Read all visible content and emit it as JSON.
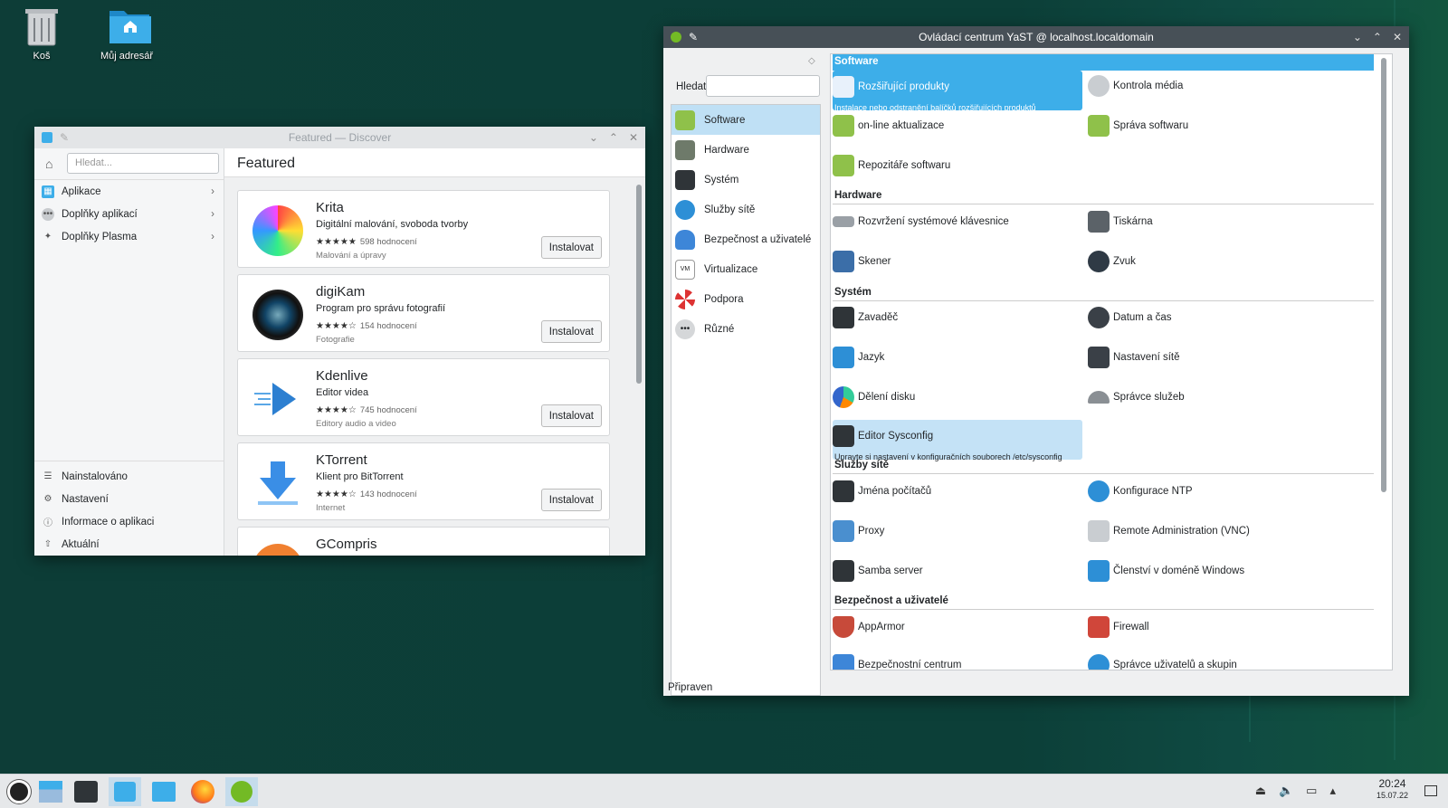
{
  "desktop": {
    "icons": [
      {
        "label": "Koš"
      },
      {
        "label": "Můj adresář"
      }
    ]
  },
  "discover": {
    "title": "Featured — Discover",
    "search_placeholder": "Hledat...",
    "nav": [
      {
        "label": "Aplikace"
      },
      {
        "label": "Doplňky aplikací"
      },
      {
        "label": "Doplňky Plasma"
      }
    ],
    "bottom_nav": [
      {
        "label": "Nainstalováno"
      },
      {
        "label": "Nastavení"
      },
      {
        "label": "Informace o aplikaci"
      },
      {
        "label": "Aktuální"
      }
    ],
    "heading": "Featured",
    "apps": [
      {
        "name": "Krita",
        "desc": "Digitální malování, svoboda tvorby",
        "stars": "★★★★★",
        "ratings": "598 hodnocení",
        "category": "Malování a úpravy",
        "button": "Instalovat"
      },
      {
        "name": "digiKam",
        "desc": "Program pro správu fotografií",
        "stars": "★★★★☆",
        "ratings": "154 hodnocení",
        "category": "Fotografie",
        "button": "Instalovat"
      },
      {
        "name": "Kdenlive",
        "desc": "Editor videa",
        "stars": "★★★★☆",
        "ratings": "745 hodnocení",
        "category": "Editory audio a video",
        "button": "Instalovat"
      },
      {
        "name": "KTorrent",
        "desc": "Klient pro BitTorrent",
        "stars": "★★★★☆",
        "ratings": "143 hodnocení",
        "category": "Internet",
        "button": "Instalovat"
      },
      {
        "name": "GCompris"
      }
    ]
  },
  "yast": {
    "title": "Ovládací centrum YaST @ localhost.localdomain",
    "search_label": "Hledat",
    "categories": [
      {
        "label": "Software"
      },
      {
        "label": "Hardware"
      },
      {
        "label": "Systém"
      },
      {
        "label": "Služby sítě"
      },
      {
        "label": "Bezpečnost a uživatelé"
      },
      {
        "label": "Virtualizace"
      },
      {
        "label": "Podpora"
      },
      {
        "label": "Různé"
      }
    ],
    "sections": {
      "software": "Software",
      "hardware": "Hardware",
      "system": "Systém",
      "network": "Služby sítě",
      "security": "Bezpečnost a uživatelé"
    },
    "modules": {
      "addon": {
        "label": "Rozšiřující produkty",
        "sub": "Instalace nebo odstranění balíčků rozšiřujících produktů"
      },
      "media_check": "Kontrola média",
      "online_update": "on-line aktualizace",
      "sw_manage": "Správa softwaru",
      "repos": "Repozitáře softwaru",
      "keyboard": "Rozvržení systémové klávesnice",
      "printer": "Tiskárna",
      "scanner": "Skener",
      "sound": "Zvuk",
      "bootloader": "Zavaděč",
      "datetime": "Datum a čas",
      "language": "Jazyk",
      "network": "Nastavení sítě",
      "partitioner": "Dělení disku",
      "services": "Správce služeb",
      "sysconfig": {
        "label": "Editor Sysconfig",
        "sub": "Upravte si nastavení v konfiguračních souborech /etc/sysconfig"
      },
      "hostnames": "Jména počítačů",
      "ntp": "Konfigurace NTP",
      "proxy": "Proxy",
      "vnc": "Remote Administration (VNC)",
      "samba": "Samba server",
      "windows_domain": "Členství v doméně Windows",
      "apparmor": "AppArmor",
      "firewall": "Firewall",
      "sec_center": "Bezpečnostní centrum",
      "users": "Správce uživatelů a skupin"
    },
    "status": "Připraven"
  },
  "taskbar": {
    "time": "20:24",
    "date": "15.07.22"
  }
}
